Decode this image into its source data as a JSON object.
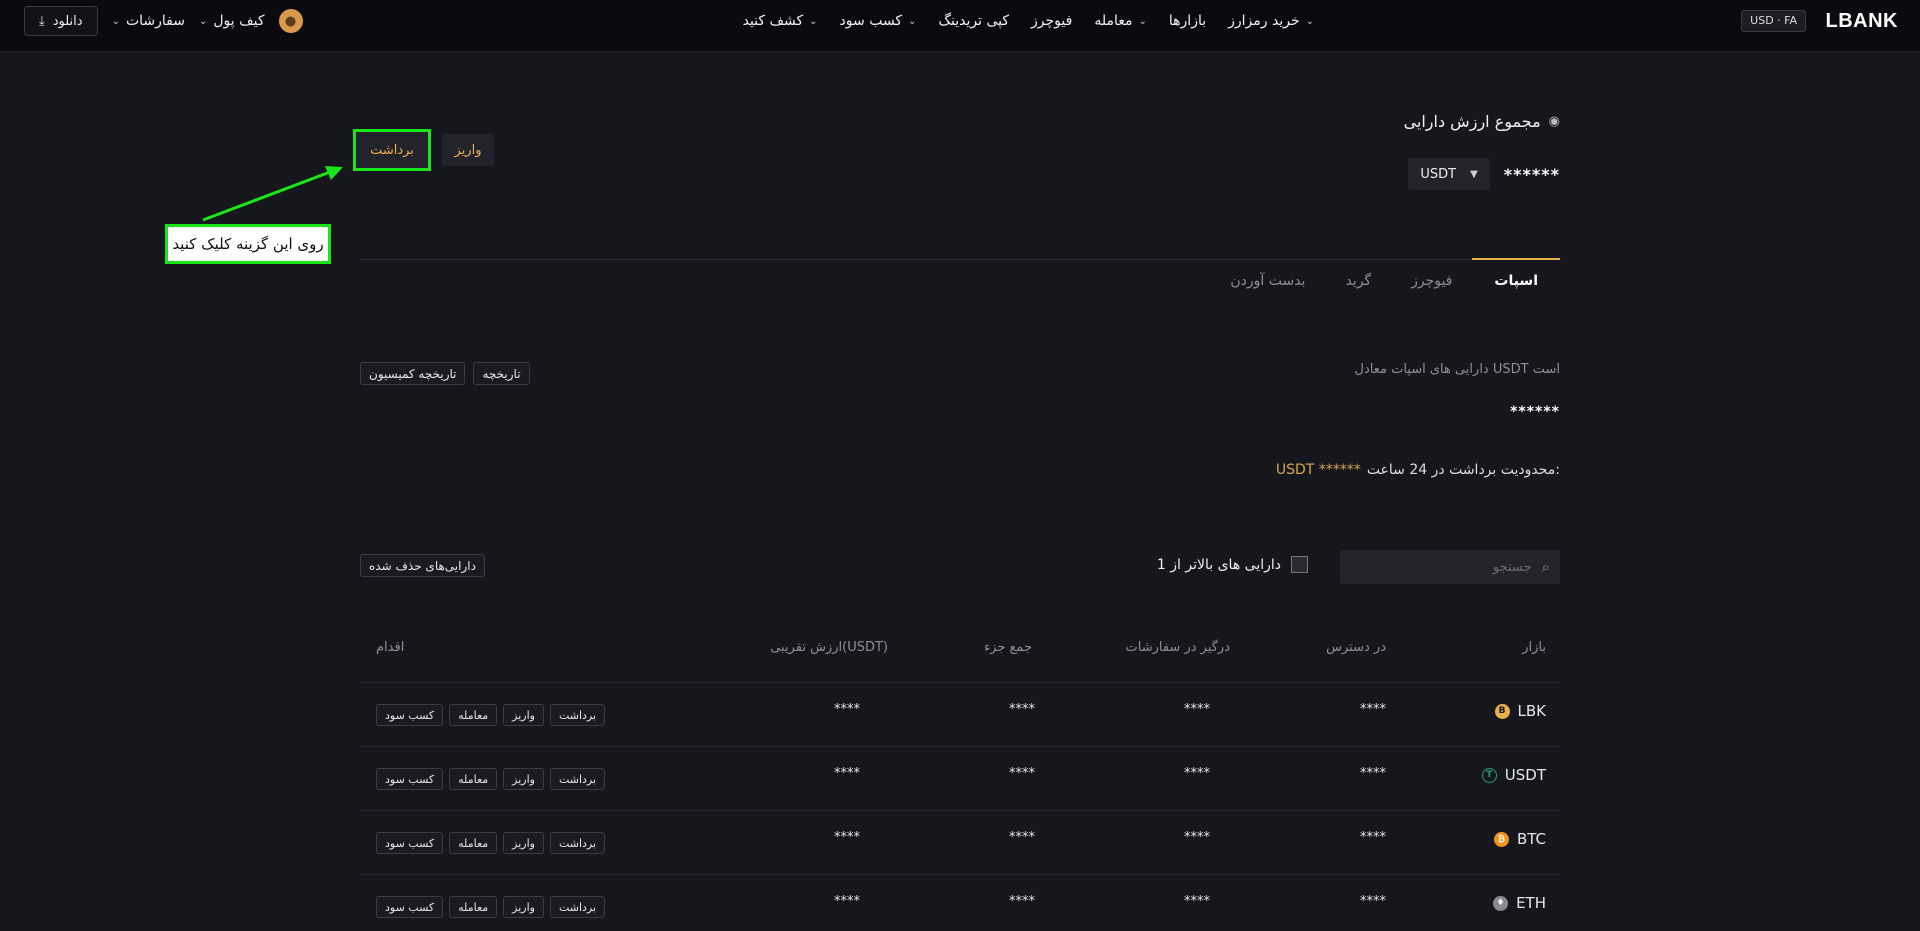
{
  "topbar": {
    "logo": "LBANK",
    "lang": "USD · FA",
    "nav": [
      {
        "label": "خرید رمزارز",
        "dropdown": true
      },
      {
        "label": "بازارها",
        "dropdown": false
      },
      {
        "label": "معامله",
        "dropdown": true
      },
      {
        "label": "فیوچرز",
        "dropdown": false
      },
      {
        "label": "کپی تریدینگ",
        "dropdown": false
      },
      {
        "label": "کسب سود",
        "dropdown": true
      },
      {
        "label": "کشف کنید",
        "dropdown": true
      }
    ],
    "wallet": "کیف پول",
    "orders": "سفارشات",
    "download": "دانلود"
  },
  "summary": {
    "title": "مجموع ارزش دارایی",
    "total": "******",
    "currency": "USDT",
    "deposit": "واریز",
    "withdraw": "برداشت"
  },
  "callout": "روی این گزینه کلیک کنید",
  "tabs": [
    "اسپات",
    "فیوچرز",
    "گرید",
    "بدست آوردن"
  ],
  "spot": {
    "label": "دارایی های اسپات معادل USDT است",
    "value": "******",
    "limit_label": "محدودیت برداشت در 24 ساعت:",
    "limit_value": "USDT ******",
    "history": "تاریخچه",
    "commission_history": "تاریخچه کمیسیون"
  },
  "filters": {
    "search_placeholder": "جستجو",
    "above_one": "دارایی های بالاتر از 1",
    "deleted": "دارایی‌های حذف شده"
  },
  "table": {
    "headers": [
      "بازار",
      "در دسترس",
      "درگیر در سفارشات",
      "جمع جزء",
      "ارزش تقریبی(USDT)",
      "اقدام"
    ],
    "rows": [
      {
        "coin": "LBK",
        "available": "****",
        "in_orders": "****",
        "subtotal": "****",
        "approx": "****"
      },
      {
        "coin": "USDT",
        "available": "****",
        "in_orders": "****",
        "subtotal": "****",
        "approx": "****"
      },
      {
        "coin": "BTC",
        "available": "****",
        "in_orders": "****",
        "subtotal": "****",
        "approx": "****"
      },
      {
        "coin": "ETH",
        "available": "****",
        "in_orders": "****",
        "subtotal": "****",
        "approx": "****"
      }
    ],
    "actions": [
      "برداشت",
      "واریز",
      "معامله",
      "کسب سود"
    ]
  },
  "colors": {
    "accent": "#e8b04b",
    "highlight": "#19e619",
    "background": "#16161d"
  }
}
